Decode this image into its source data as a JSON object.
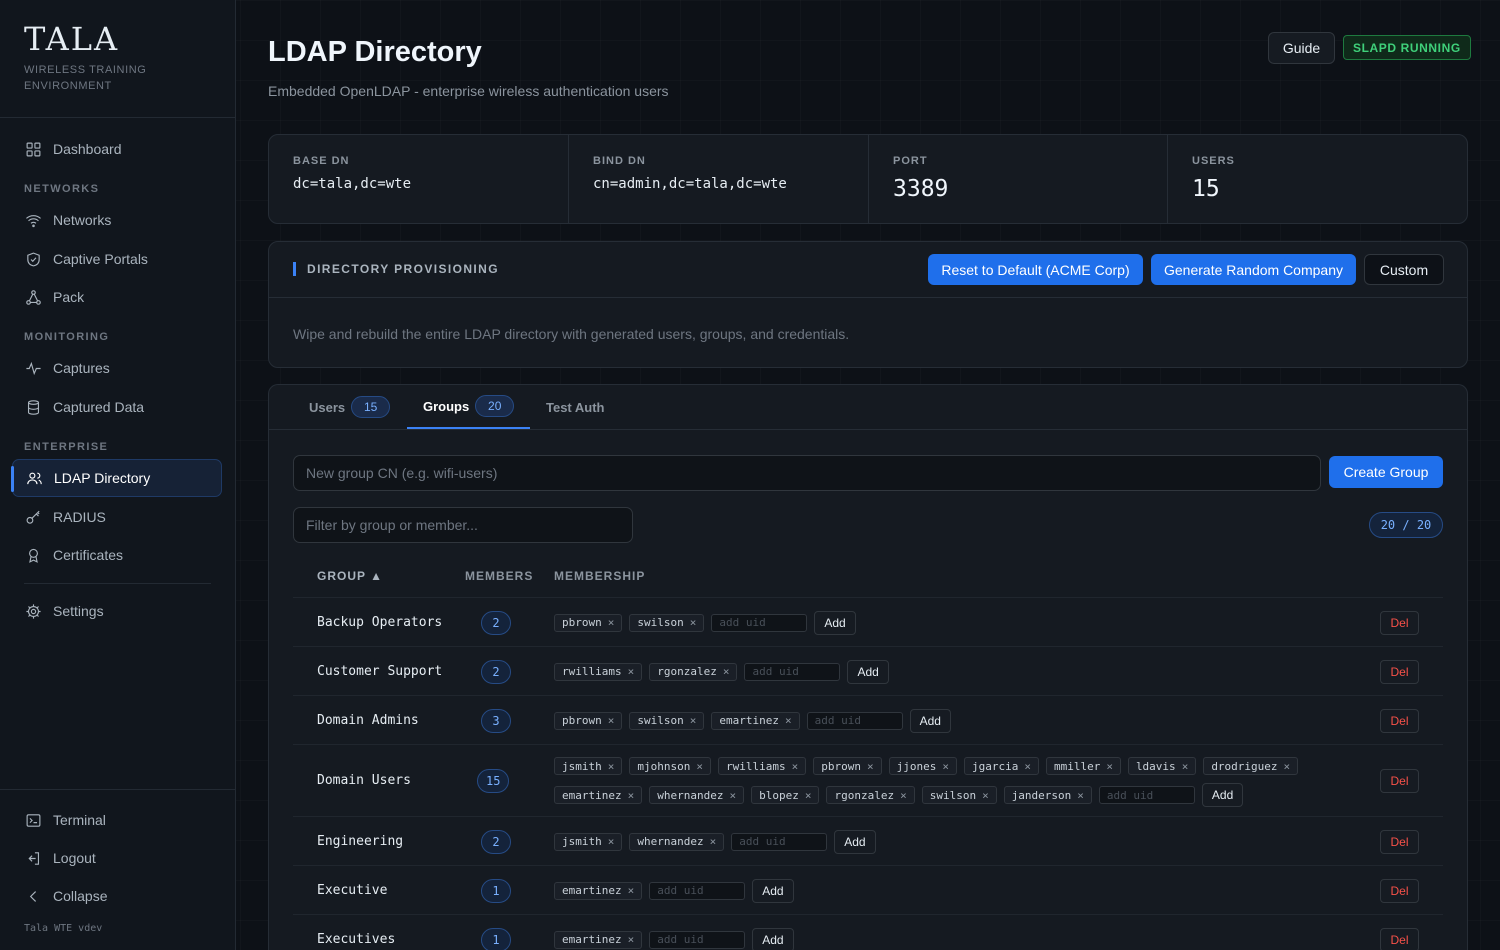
{
  "brand": {
    "logo": "TALA",
    "subtitle": "WIRELESS TRAINING ENVIRONMENT",
    "version": "Tala WTE vdev"
  },
  "sidebar": {
    "dashboard": "Dashboard",
    "sec_networks": "NETWORKS",
    "networks": "Networks",
    "captive": "Captive Portals",
    "pack": "Pack",
    "sec_monitoring": "MONITORING",
    "captures": "Captures",
    "captured_data": "Captured Data",
    "sec_enterprise": "ENTERPRISE",
    "ldap": "LDAP Directory",
    "radius": "RADIUS",
    "certs": "Certificates",
    "settings": "Settings",
    "terminal": "Terminal",
    "logout": "Logout",
    "collapse": "Collapse"
  },
  "header": {
    "title": "LDAP Directory",
    "subtitle": "Embedded OpenLDAP - enterprise wireless authentication users",
    "guide": "Guide",
    "status": "SLAPD RUNNING"
  },
  "stats": {
    "base_dn_label": "BASE DN",
    "base_dn": "dc=tala,dc=wte",
    "bind_dn_label": "BIND DN",
    "bind_dn": "cn=admin,dc=tala,dc=wte",
    "port_label": "PORT",
    "port": "3389",
    "users_label": "USERS",
    "users": "15"
  },
  "provisioning": {
    "title": "DIRECTORY PROVISIONING",
    "reset": "Reset to Default (ACME Corp)",
    "generate": "Generate Random Company",
    "custom": "Custom",
    "description": "Wipe and rebuild the entire LDAP directory with generated users, groups, and credentials."
  },
  "tabs": {
    "users": "Users",
    "users_count": "15",
    "groups": "Groups",
    "groups_count": "20",
    "test": "Test Auth"
  },
  "groups_panel": {
    "new_placeholder": "New group CN (e.g. wifi-users)",
    "create": "Create Group",
    "filter_placeholder": "Filter by group or member...",
    "count": "20 / 20",
    "col_group": "GROUP ▲",
    "col_members": "MEMBERS",
    "col_membership": "MEMBERSHIP",
    "uid_placeholder": "add uid",
    "add": "Add",
    "del": "Del"
  },
  "groups": [
    {
      "name": "Backup Operators",
      "count": "2",
      "members": [
        "pbrown",
        "swilson"
      ]
    },
    {
      "name": "Customer Support",
      "count": "2",
      "members": [
        "rwilliams",
        "rgonzalez"
      ]
    },
    {
      "name": "Domain Admins",
      "count": "3",
      "members": [
        "pbrown",
        "swilson",
        "emartinez"
      ]
    },
    {
      "name": "Domain Users",
      "count": "15",
      "members": [
        "jsmith",
        "mjohnson",
        "rwilliams",
        "pbrown",
        "jjones",
        "jgarcia",
        "mmiller",
        "ldavis",
        "drodriguez",
        "emartinez",
        "whernandez",
        "blopez",
        "rgonzalez",
        "swilson",
        "janderson"
      ]
    },
    {
      "name": "Engineering",
      "count": "2",
      "members": [
        "jsmith",
        "whernandez"
      ]
    },
    {
      "name": "Executive",
      "count": "1",
      "members": [
        "emartinez"
      ]
    },
    {
      "name": "Executives",
      "count": "1",
      "members": [
        "emartinez"
      ]
    }
  ],
  "colors": {
    "accent": "#1f6feb",
    "status": "#3fd07a",
    "danger": "#f85149"
  }
}
